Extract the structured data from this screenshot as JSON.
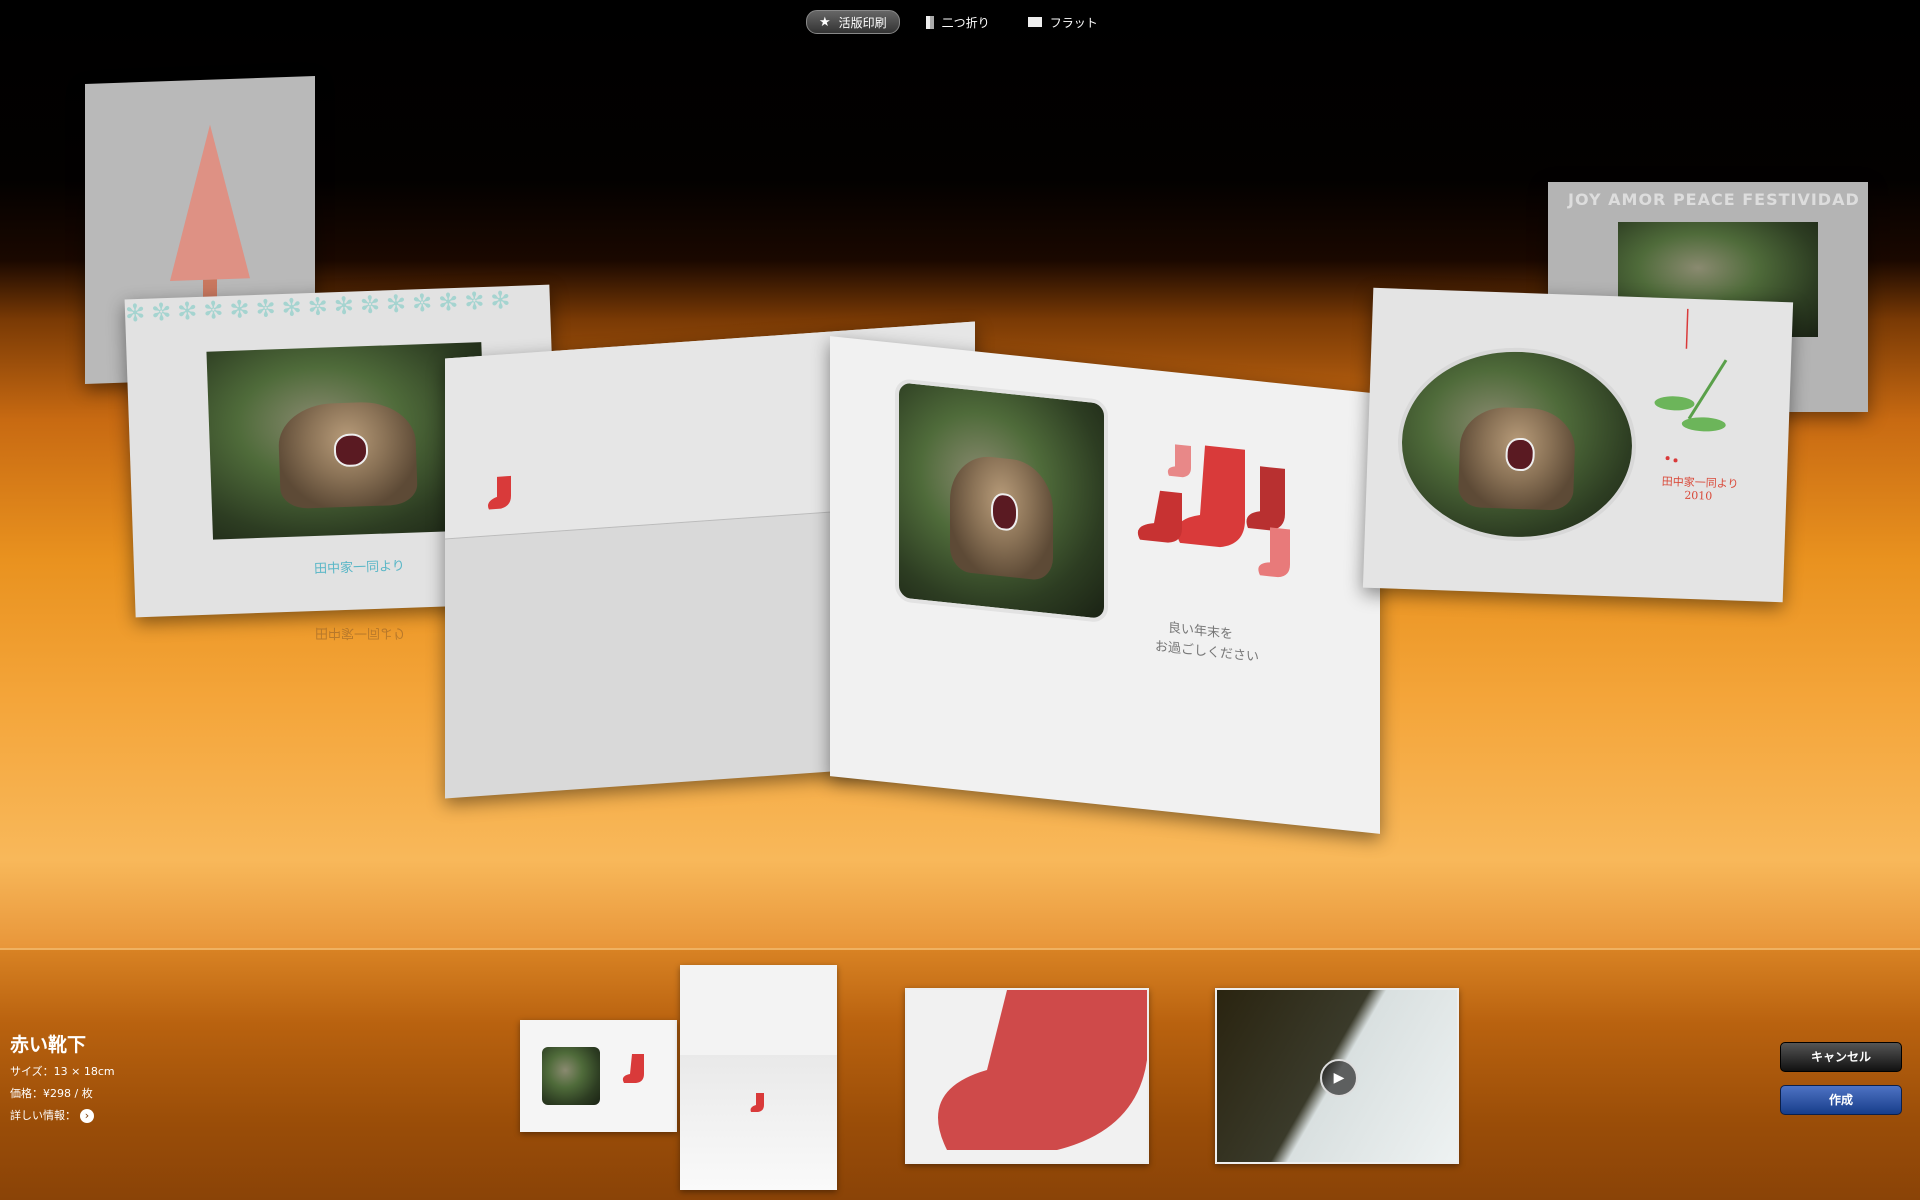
{
  "modes": [
    {
      "label": "活版印刷",
      "icon": "star-icon",
      "active": true
    },
    {
      "label": "二つ折り",
      "icon": "folded-card-icon",
      "active": false
    },
    {
      "label": "フラット",
      "icon": "flat-card-icon",
      "active": false
    }
  ],
  "cards": {
    "left_message": "田中家一同より",
    "left_message_reflection": "田中家一同より",
    "center_message_line1": "良い年末を",
    "center_message_line2": "お過ごしください",
    "right_message_line1": "田中家一同より",
    "right_message_line2": "2010",
    "back_right_words": "JOY AMOR PEACE FESTIVIDAD"
  },
  "info": {
    "title": "赤い靴下",
    "size": "サイズ：13 × 18cm",
    "price": "価格：¥298 / 枚",
    "details": "詳しい情報："
  },
  "buttons": {
    "cancel": "キャンセル",
    "create": "作成"
  },
  "colors": {
    "accent_red": "#d93a3a",
    "create_blue": "#2b53a8"
  }
}
